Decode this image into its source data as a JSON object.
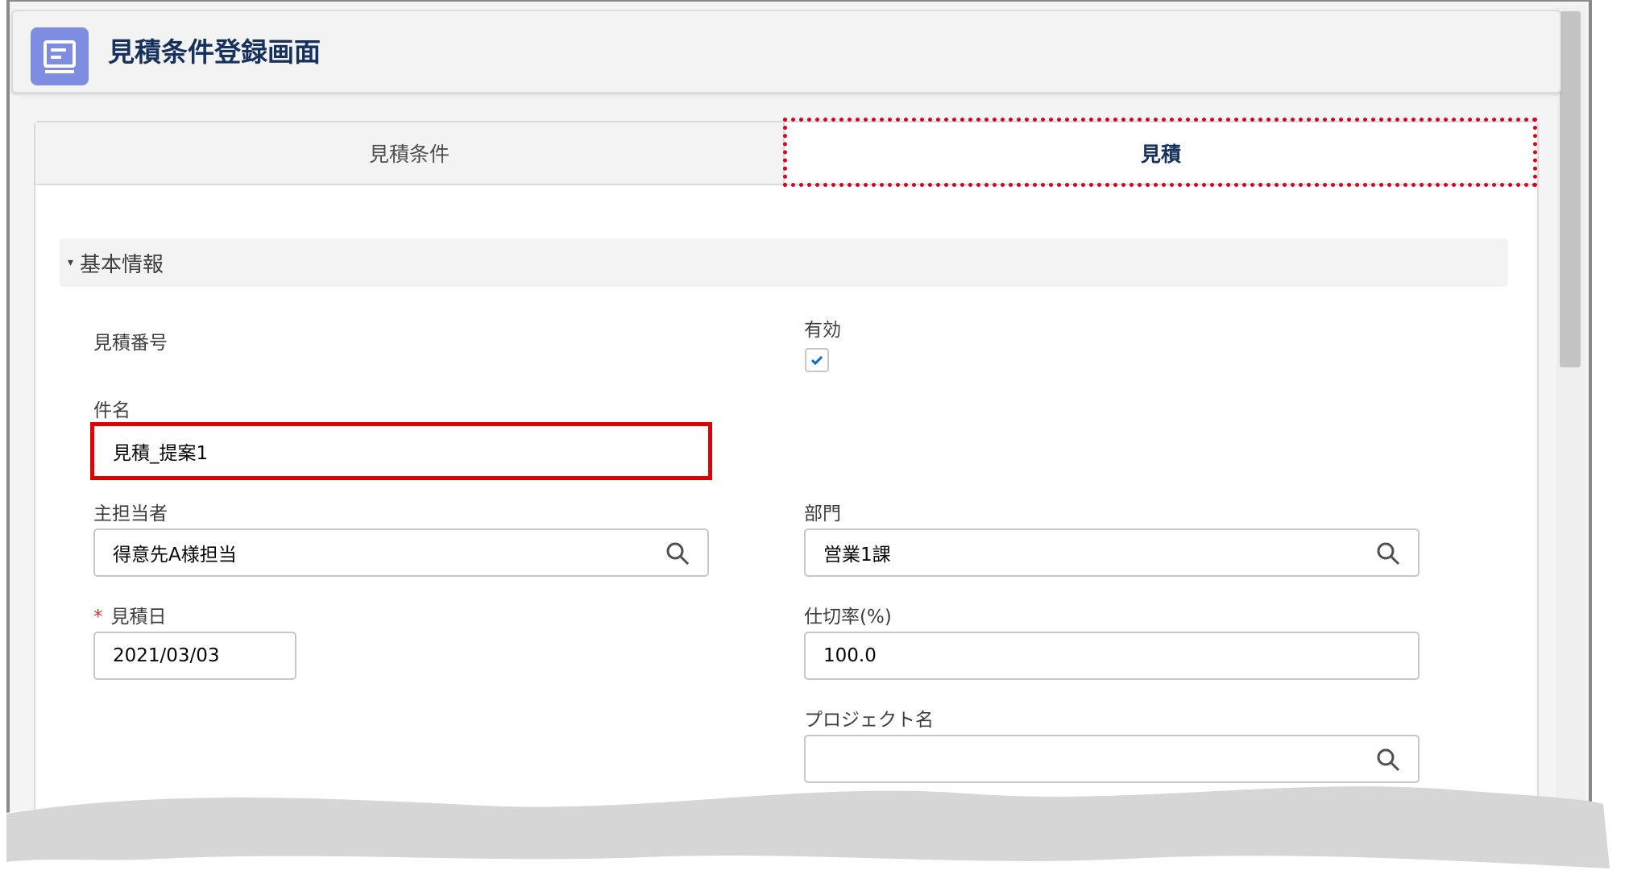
{
  "header": {
    "title": "見積条件登録画面",
    "icon": "record-icon"
  },
  "tabs": [
    {
      "label": "見積条件",
      "active": false
    },
    {
      "label": "見積",
      "active": true
    }
  ],
  "section": {
    "title": "基本情報"
  },
  "fields": {
    "quote_number": {
      "label": "見積番号"
    },
    "valid": {
      "label": "有効",
      "checked": true
    },
    "subject": {
      "label": "件名",
      "value": "見積_提案1"
    },
    "owner": {
      "label": "主担当者",
      "value": "得意先A様担当"
    },
    "department": {
      "label": "部門",
      "value": "営業1課"
    },
    "quote_date": {
      "label": "見積日",
      "required_mark": "*",
      "value": "2021/03/03"
    },
    "rate": {
      "label": "仕切率(%)",
      "value": "100.0"
    },
    "project": {
      "label": "プロジェクト名",
      "value": ""
    }
  },
  "colors": {
    "accent": "#7f8de1",
    "highlight": "#e00000",
    "title": "#16325c"
  }
}
